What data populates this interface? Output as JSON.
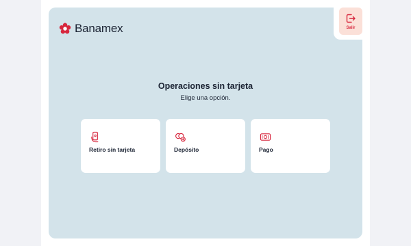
{
  "brand": {
    "name": "Banamex",
    "accent_color": "#d7263d"
  },
  "header": {
    "exit_label": "Salir",
    "exit_icon": "logout-icon"
  },
  "main": {
    "title": "Operaciones sin tarjeta",
    "subtitle": "Elige una opción."
  },
  "options": [
    {
      "label": "Retiro sin tarjeta",
      "icon": "phone-cash-icon"
    },
    {
      "label": "Depósito",
      "icon": "coins-deposit-icon"
    },
    {
      "label": "Pago",
      "icon": "bill-payment-icon"
    }
  ]
}
